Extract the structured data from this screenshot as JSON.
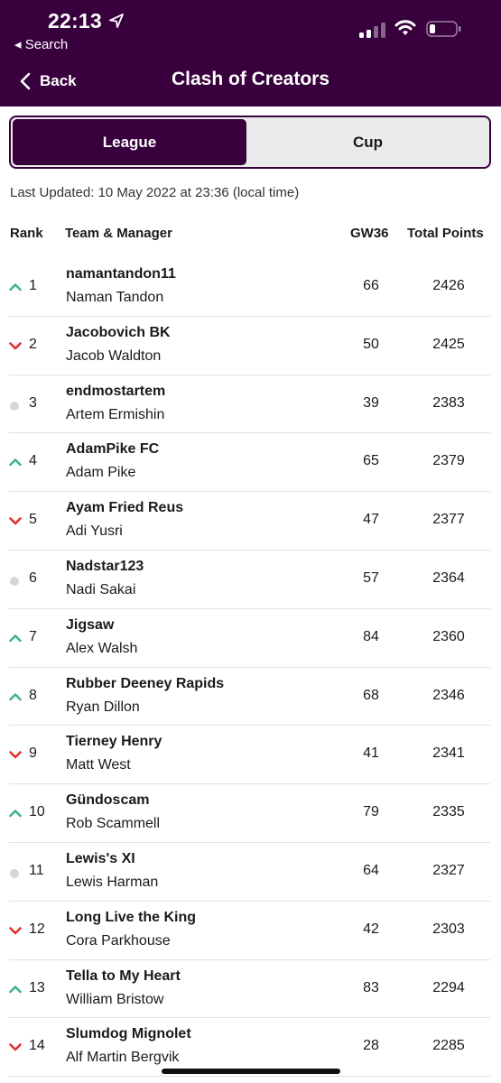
{
  "status_bar": {
    "time": "22:13",
    "back_app": "◂ Search"
  },
  "nav": {
    "back_label": "Back",
    "title": "Clash of Creators"
  },
  "tabs": {
    "league": "League",
    "cup": "Cup",
    "selected": "League"
  },
  "last_updated": "Last Updated: 10 May 2022 at 23:36 (local time)",
  "table": {
    "headers": {
      "rank": "Rank",
      "team": "Team & Manager",
      "gw": "GW36",
      "total": "Total Points"
    },
    "rows": [
      {
        "movement": "up",
        "rank": "1",
        "team": "namantandon11",
        "manager": "Naman Tandon",
        "gw": "66",
        "total": "2426"
      },
      {
        "movement": "down",
        "rank": "2",
        "team": "Jacobovich BK",
        "manager": "Jacob Waldton",
        "gw": "50",
        "total": "2425"
      },
      {
        "movement": "same",
        "rank": "3",
        "team": "endmostartem",
        "manager": "Artem Ermishin",
        "gw": "39",
        "total": "2383"
      },
      {
        "movement": "up",
        "rank": "4",
        "team": "AdamPike FC",
        "manager": "Adam Pike",
        "gw": "65",
        "total": "2379"
      },
      {
        "movement": "down",
        "rank": "5",
        "team": "Ayam Fried Reus",
        "manager": "Adi Yusri",
        "gw": "47",
        "total": "2377"
      },
      {
        "movement": "same",
        "rank": "6",
        "team": "Nadstar123",
        "manager": "Nadi Sakai",
        "gw": "57",
        "total": "2364"
      },
      {
        "movement": "up",
        "rank": "7",
        "team": "Jigsaw",
        "manager": "Alex Walsh",
        "gw": "84",
        "total": "2360"
      },
      {
        "movement": "up",
        "rank": "8",
        "team": "Rubber Deeney Rapids",
        "manager": "Ryan Dillon",
        "gw": "68",
        "total": "2346"
      },
      {
        "movement": "down",
        "rank": "9",
        "team": "Tierney Henry",
        "manager": "Matt West",
        "gw": "41",
        "total": "2341"
      },
      {
        "movement": "up",
        "rank": "10",
        "team": "Gündoscam",
        "manager": "Rob Scammell",
        "gw": "79",
        "total": "2335"
      },
      {
        "movement": "same",
        "rank": "11",
        "team": "Lewis's XI",
        "manager": "Lewis Harman",
        "gw": "64",
        "total": "2327"
      },
      {
        "movement": "down",
        "rank": "12",
        "team": "Long Live the King",
        "manager": "Cora Parkhouse",
        "gw": "42",
        "total": "2303"
      },
      {
        "movement": "up",
        "rank": "13",
        "team": "Tella to My Heart",
        "manager": "William Bristow",
        "gw": "83",
        "total": "2294"
      },
      {
        "movement": "down",
        "rank": "14",
        "team": "Slumdog Mignolet",
        "manager": "Alf Martin Bergvik",
        "gw": "28",
        "total": "2285"
      }
    ]
  },
  "colors": {
    "brand": "#38003c",
    "up": "#3bb77e",
    "down": "#e03131",
    "same": "#d6d6d6"
  }
}
